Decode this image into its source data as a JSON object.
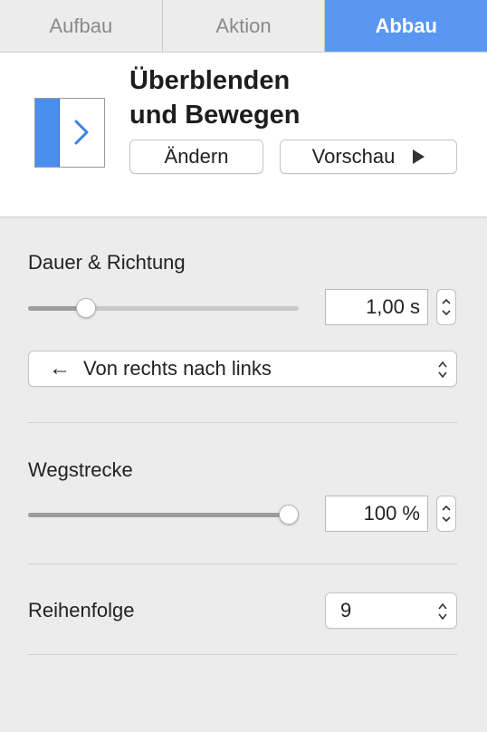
{
  "tabs": [
    {
      "label": "Aufbau",
      "active": false
    },
    {
      "label": "Aktion",
      "active": false
    },
    {
      "label": "Abbau",
      "active": true
    }
  ],
  "accent_color": "#5a97f3",
  "effect": {
    "title_line1": "Überblenden",
    "title_line2": "und Bewegen",
    "icon": "push-right-icon",
    "change_label": "Ändern",
    "preview_label": "Vorschau"
  },
  "duration": {
    "section_label": "Dauer & Richtung",
    "value": "1,00 s",
    "slider_fraction": 0.19
  },
  "direction": {
    "arrow": "←",
    "value": "Von rechts nach links"
  },
  "distance": {
    "section_label": "Wegstrecke",
    "value": "100 %",
    "slider_fraction": 1.0
  },
  "order": {
    "section_label": "Reihenfolge",
    "value": "9"
  }
}
